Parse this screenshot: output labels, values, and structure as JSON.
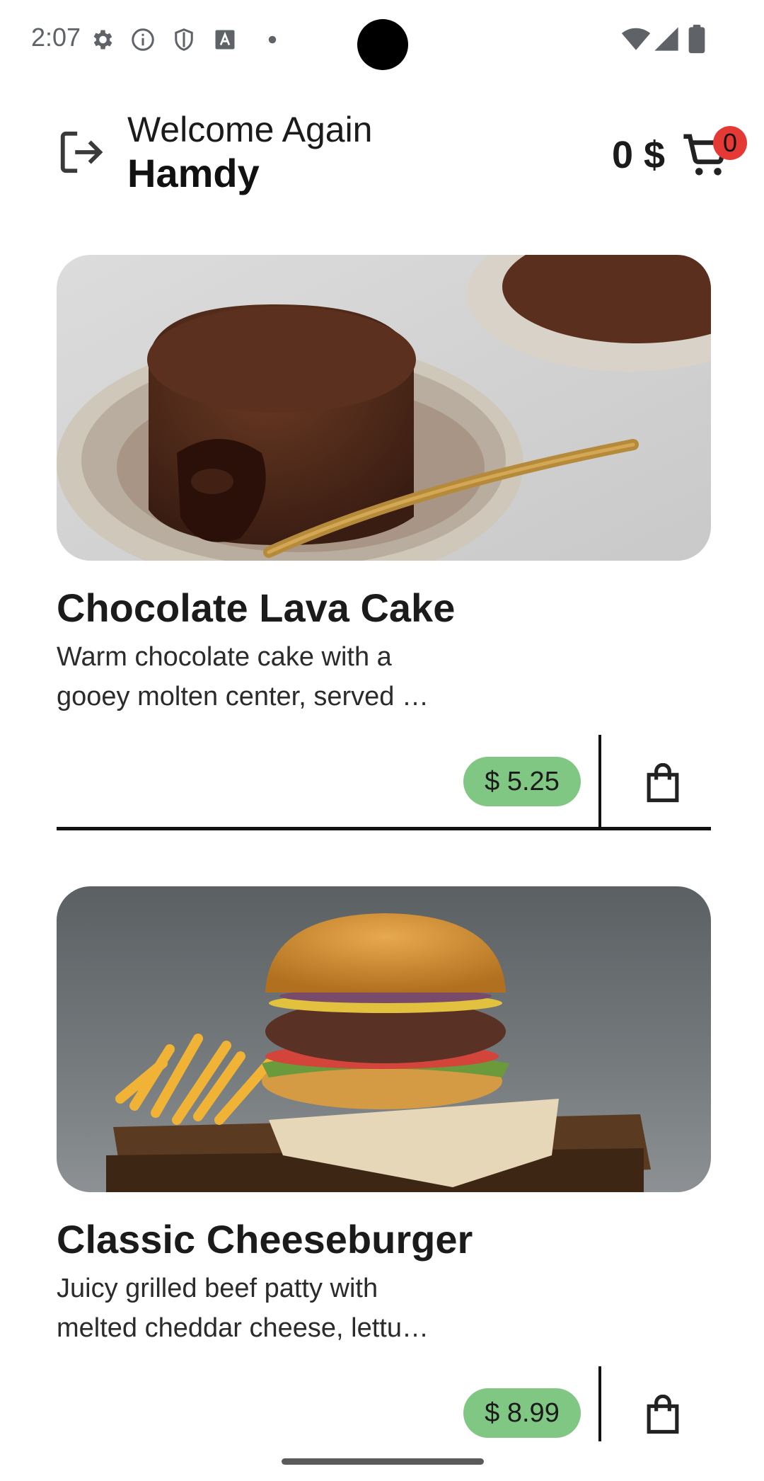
{
  "status_bar": {
    "time": "2:07",
    "left_icons": [
      "gear-icon",
      "info-icon",
      "shield-icon",
      "text-a-icon",
      "dot-icon"
    ],
    "right_icons": [
      "wifi-icon",
      "cellular-icon",
      "battery-icon"
    ]
  },
  "header": {
    "welcome": "Welcome Again",
    "user_name": "Hamdy",
    "cart_total": "0 $",
    "cart_count": "0",
    "logout_icon": "logout-icon",
    "cart_icon": "shopping-cart-icon"
  },
  "products": [
    {
      "name": "Chocolate Lava Cake",
      "description_lines": [
        "Warm chocolate cake with a",
        "gooey molten center, served …"
      ],
      "price": "$ 5.25",
      "bag_icon": "shopping-bag-icon",
      "image": "chocolate-lava-cake-photo"
    },
    {
      "name": "Classic Cheeseburger",
      "description_lines": [
        "Juicy grilled beef patty with",
        "melted cheddar cheese, lettu…"
      ],
      "price": "$ 8.99",
      "bag_icon": "shopping-bag-icon",
      "image": "cheeseburger-photo"
    }
  ],
  "colors": {
    "price_badge": "#80c783",
    "cart_badge": "#e53935",
    "divider": "#111111"
  }
}
